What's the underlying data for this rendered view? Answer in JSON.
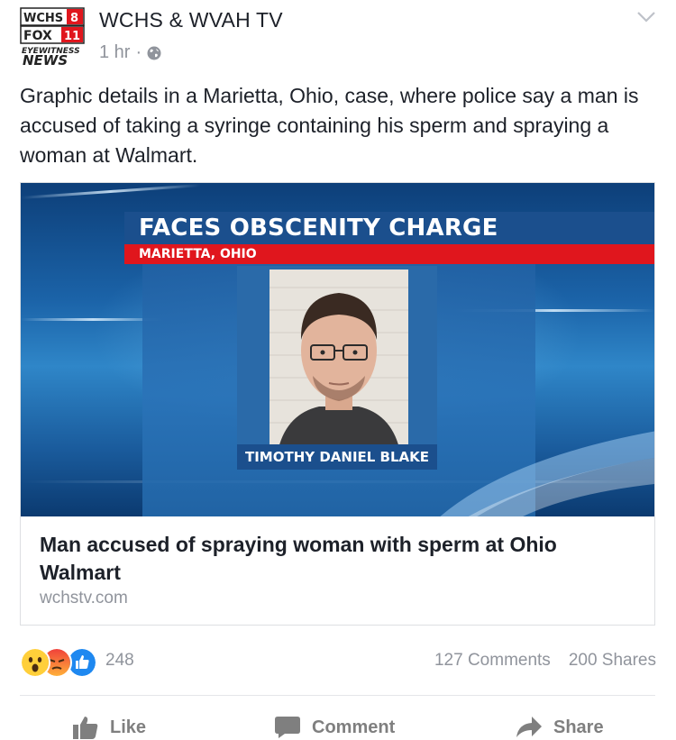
{
  "header": {
    "logo": {
      "line1": "WCHS",
      "line1_num": "8",
      "line2": "FOX",
      "line2_num": "11",
      "line3": "EYEWITNESS",
      "line4": "NEWS"
    },
    "page_name": "WCHS & WVAH TV",
    "time": "1 hr",
    "separator": "·",
    "privacy_icon": "globe-icon",
    "menu_icon": "chevron-down-icon"
  },
  "post": {
    "text": "Graphic details in a Marietta, Ohio, case, where police say a man is accused of taking a syringe containing his sperm and spraying a woman at Walmart."
  },
  "link_card": {
    "image": {
      "headline": "FACES OBSCENITY CHARGE",
      "location": "MARIETTA, OHIO",
      "person_name": "TIMOTHY DANIEL BLAKE"
    },
    "title": "Man accused of spraying woman with sperm at Ohio Walmart",
    "domain": "wchstv.com"
  },
  "engagement": {
    "reaction_icons": [
      "wow-reaction-icon",
      "angry-reaction-icon",
      "like-reaction-icon"
    ],
    "reaction_count": "248",
    "comments": "127 Comments",
    "shares": "200 Shares"
  },
  "actions": {
    "like": "Like",
    "comment": "Comment",
    "share": "Share"
  },
  "colors": {
    "text": "#1d2129",
    "meta": "#90949c",
    "action": "#7f7f7f",
    "like_blue": "#1e88f0",
    "angry_red": "#f0413a",
    "wow_yellow": "#ffcf3a",
    "news_red": "#e0161d",
    "news_blue": "#1b4f8d"
  }
}
